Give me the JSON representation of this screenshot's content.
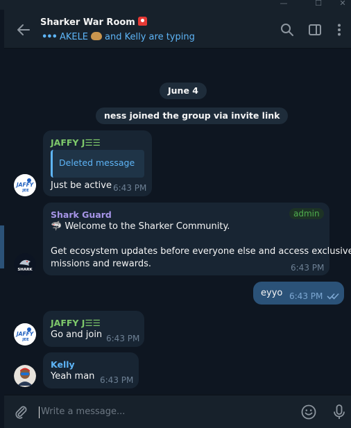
{
  "header": {
    "title": "Sharker War Room",
    "title_icon": "siren-emoji",
    "typing_dots": "•••",
    "typing_name1": "AKELE",
    "typing_emoji": "bread-emoji",
    "typing_rest": "and Kelly are typing"
  },
  "window_controls": {
    "minimize": "—",
    "maximize": "☐",
    "close": "✕"
  },
  "chat": {
    "date_label": "June 4",
    "service_message": "ness joined the group via invite link",
    "messages": [
      {
        "sender": "JAFFY J☰☰",
        "sender_color": "#7ec96b",
        "reply_text": "Deleted message",
        "text": "Just be active",
        "time": "6:43 PM"
      },
      {
        "sender": "Shark Guard",
        "sender_color": "#a695e7",
        "badge": "admin",
        "line1": "🦈 Welcome to the Sharker Community.",
        "line2": "Get ecosystem updates before everyone else and access exclusive",
        "line3": "missions and rewards.",
        "time": "6:43 PM"
      },
      {
        "text": "eyyo",
        "time": "6:43 PM",
        "status": "read"
      },
      {
        "sender": "JAFFY J☰☰",
        "sender_color": "#7ec96b",
        "text": "Go and join",
        "time": "6:43 PM"
      },
      {
        "sender": "Kelly",
        "sender_color": "#5eb5f7",
        "text": "Yeah man",
        "time": "6:43 PM"
      }
    ]
  },
  "avatars": {
    "jaffy_text": "JAFFY",
    "jaffy_sub": "JEE",
    "shark_text": "SHARK"
  },
  "composer": {
    "placeholder": "Write a message..."
  },
  "colors": {
    "background": "#0e1621",
    "panel": "#17212b",
    "incoming": "#182533",
    "outgoing": "#2b5278",
    "accent": "#5eb5f7"
  }
}
